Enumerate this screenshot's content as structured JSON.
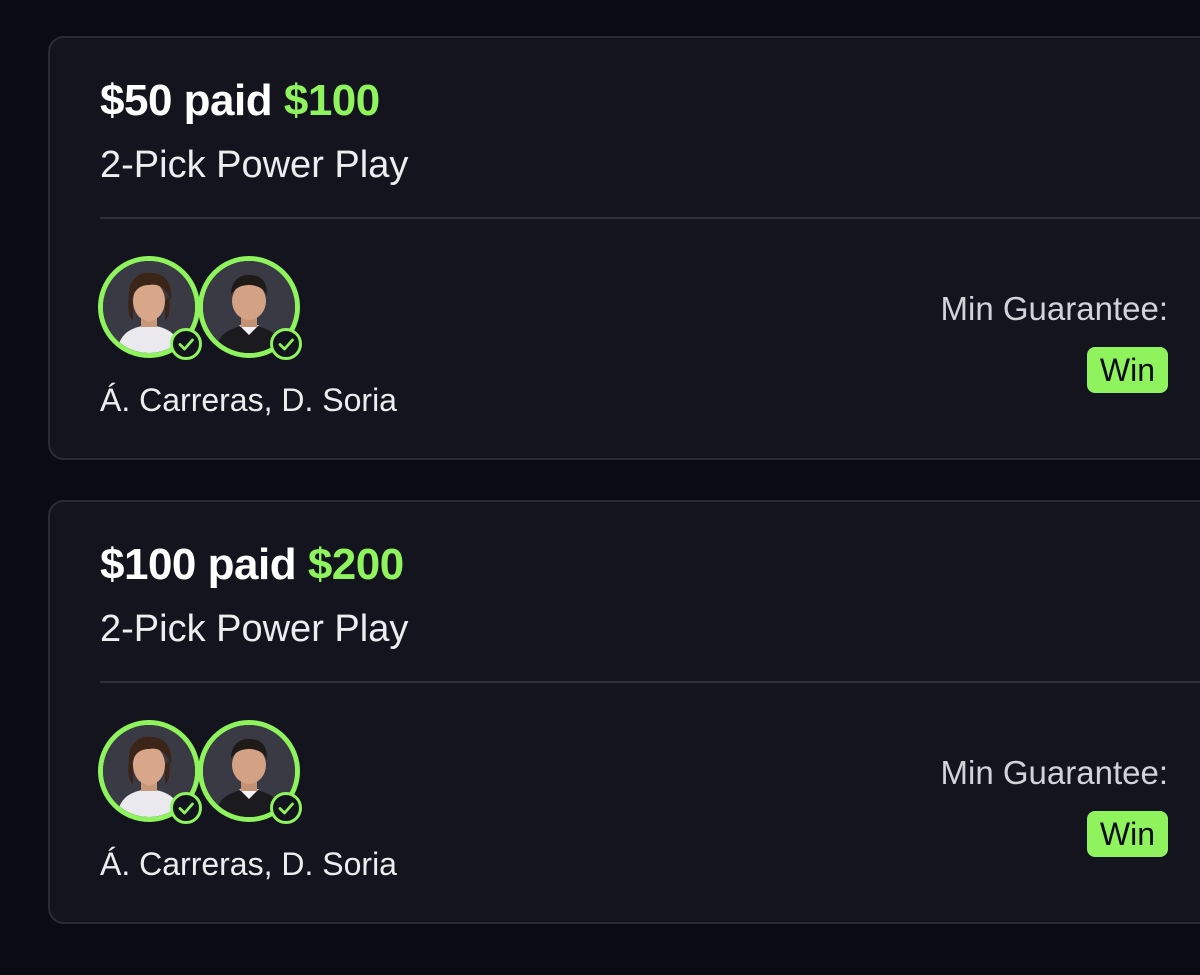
{
  "colors": {
    "background": "#0b0b14",
    "card": "#14141f",
    "accent_green": "#8ef35c",
    "text": "#ffffff"
  },
  "entries": [
    {
      "stake": "$50",
      "paid_word": "paid",
      "payout": "$100",
      "play_type": "2-Pick Power Play",
      "players": "Á. Carreras, D. Soria",
      "guarantee_label": "Min Guarantee:",
      "result": "Win",
      "avatar_icons": [
        "player-headshot-icon",
        "player-headshot-icon"
      ],
      "status_icon": "check-circle-icon"
    },
    {
      "stake": "$100",
      "paid_word": "paid",
      "payout": "$200",
      "play_type": "2-Pick Power Play",
      "players": "Á. Carreras, D. Soria",
      "guarantee_label": "Min Guarantee:",
      "result": "Win",
      "avatar_icons": [
        "player-headshot-icon",
        "player-headshot-icon"
      ],
      "status_icon": "check-circle-icon"
    }
  ]
}
